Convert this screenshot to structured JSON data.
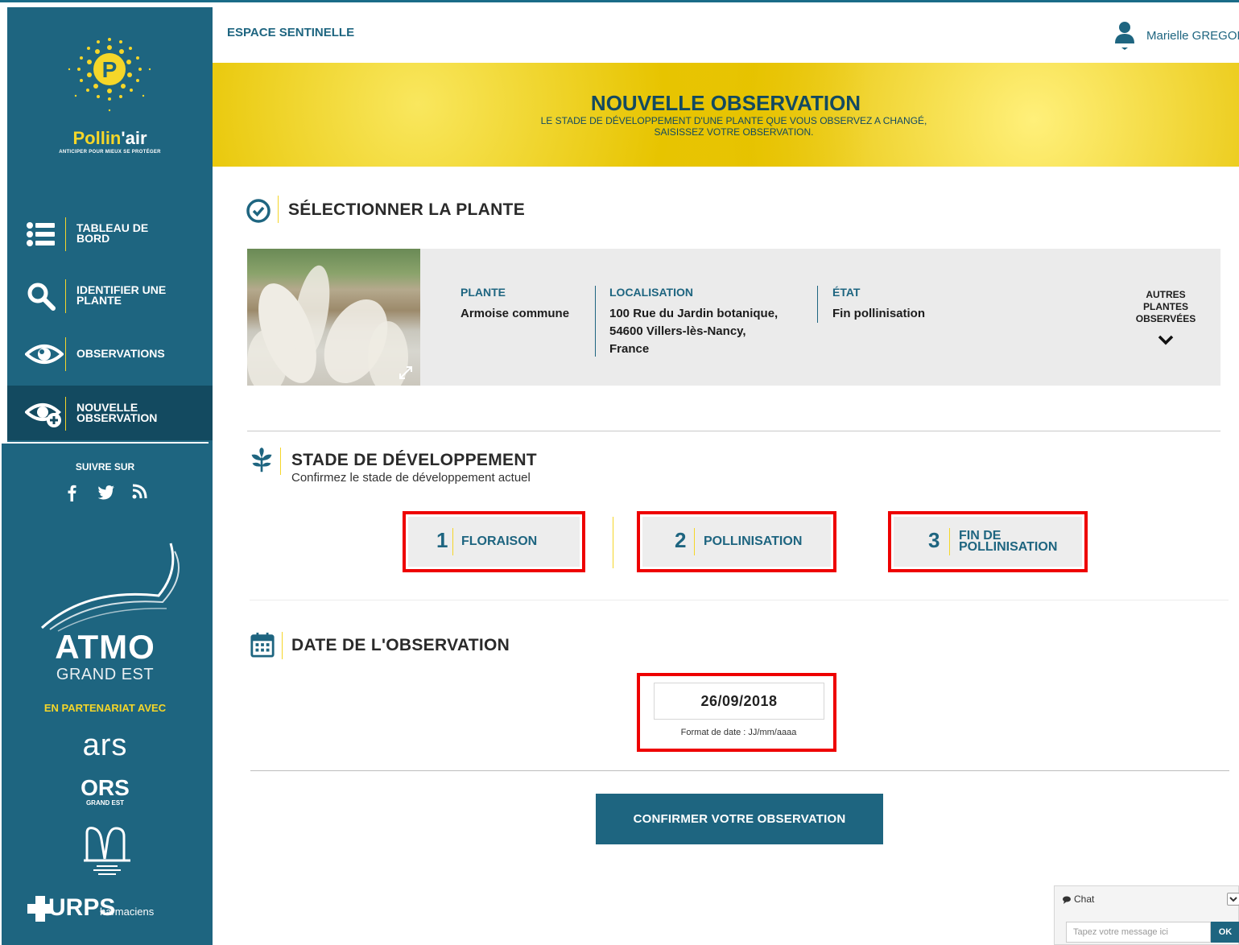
{
  "app": {
    "brand_name_part1": "Pollin",
    "brand_name_part2": "'air",
    "brand_tagline": "ANTICIPER POUR MIEUX SE PROTÉGER",
    "logo_letter": "P"
  },
  "header": {
    "section_label": "ESPACE SENTINELLE",
    "user_name": "Marielle GREGORI"
  },
  "banner": {
    "title": "NOUVELLE OBSERVATION",
    "subtitle_line1": "LE STADE DE DÉVELOPPEMENT D'UNE PLANTE QUE VOUS OBSERVEZ A CHANGÉ,",
    "subtitle_line2": "SAISISSEZ VOTRE OBSERVATION."
  },
  "sidebar": {
    "items": [
      {
        "label": "TABLEAU DE BORD",
        "icon": "list-icon"
      },
      {
        "label": "IDENTIFIER UNE PLANTE",
        "icon": "search-icon"
      },
      {
        "label": "OBSERVATIONS",
        "icon": "eye-icon"
      },
      {
        "label": "NOUVELLE OBSERVATION",
        "icon": "eye-plus-icon",
        "active": true
      }
    ],
    "follow_label": "SUIVRE SUR",
    "social": [
      "facebook-icon",
      "twitter-icon",
      "rss-icon"
    ],
    "partners": {
      "atmo": "ATMO",
      "atmo_sub": "GRAND EST",
      "partnership_label": "EN PARTENARIAT AVEC",
      "ars": "ars",
      "ors": "ORS",
      "ors_sub": "GRAND EST",
      "urps": "URPS",
      "urps_sub": "harmaciens"
    }
  },
  "select_plant": {
    "title": "SÉLECTIONNER LA PLANTE",
    "plant_label": "PLANTE",
    "plant_value": "Armoise commune",
    "location_label": "LOCALISATION",
    "location_line1": "100 Rue du Jardin botanique,",
    "location_line2": "54600 Villers-lès-Nancy,",
    "location_line3": "France",
    "state_label": "ÉTAT",
    "state_value": "Fin pollinisation",
    "other_plants_line1": "AUTRES",
    "other_plants_line2": "PLANTES",
    "other_plants_line3": "OBSERVÉES"
  },
  "stage": {
    "title": "STADE DE DÉVELOPPEMENT",
    "subtitle": "Confirmez le stade de développement actuel",
    "options": [
      {
        "num": "1",
        "label_line1": "FLORAISON",
        "label_line2": ""
      },
      {
        "num": "2",
        "label_line1": "POLLINISATION",
        "label_line2": ""
      },
      {
        "num": "3",
        "label_line1": "FIN DE",
        "label_line2": "POLLINISATION"
      }
    ]
  },
  "date": {
    "title": "DATE DE L'OBSERVATION",
    "value": "26/09/2018",
    "hint": "Format de date : JJ/mm/aaaa"
  },
  "confirm_label": "CONFIRMER VOTRE OBSERVATION",
  "chat": {
    "title": "Chat",
    "placeholder": "Tapez votre message ici",
    "send_label": "OK"
  },
  "colors": {
    "primary": "#1e6580",
    "accent": "#f5d629",
    "highlight": "#ee0000"
  }
}
